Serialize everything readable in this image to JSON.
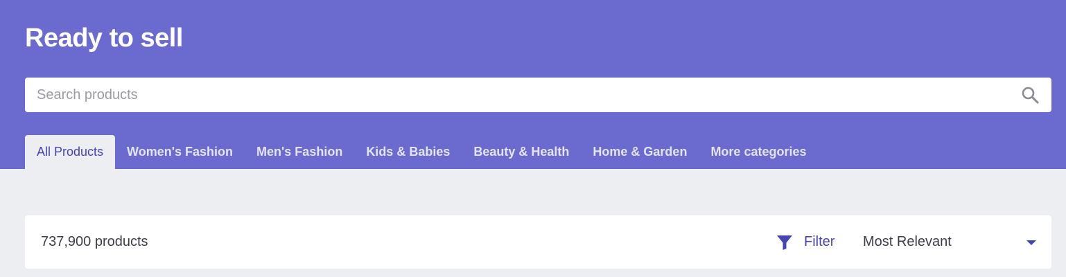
{
  "header": {
    "title": "Ready to sell",
    "background_color": "#6b6bcf"
  },
  "search": {
    "placeholder": "Search products",
    "value": "",
    "icon": "search-icon"
  },
  "tabs": [
    {
      "label": "All Products",
      "active": true
    },
    {
      "label": "Women's Fashion",
      "active": false
    },
    {
      "label": "Men's Fashion",
      "active": false
    },
    {
      "label": "Kids & Babies",
      "active": false
    },
    {
      "label": "Beauty & Health",
      "active": false
    },
    {
      "label": "Home & Garden",
      "active": false
    },
    {
      "label": "More categories",
      "active": false
    }
  ],
  "toolbar": {
    "product_count": "737,900 products",
    "filter_label": "Filter",
    "filter_icon": "filter-icon",
    "sort_value": "Most Relevant",
    "sort_icon": "chevron-down-icon",
    "accent_color": "#4545b5"
  }
}
